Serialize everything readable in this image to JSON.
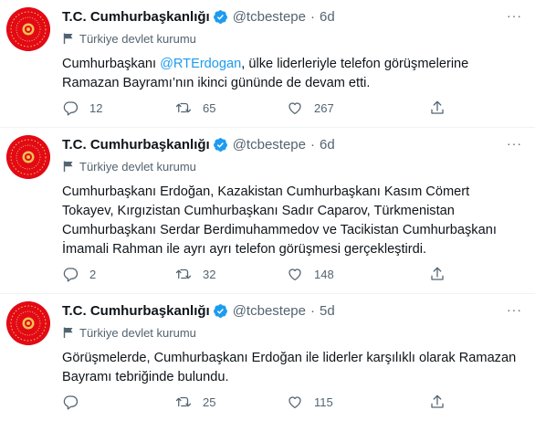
{
  "account": {
    "name": "T.C. Cumhurbaşkanlığı",
    "handle": "@tcbestepe",
    "dot": "·",
    "gov_label": "Türkiye devlet kurumu",
    "more": "···"
  },
  "colors": {
    "avatar_bg": "#e30a17",
    "verified": "#1d9bf0",
    "mention": "#1d9bf0",
    "muted": "#536471"
  },
  "tweets": [
    {
      "time": "6d",
      "text_before": "Cumhurbaşkanı ",
      "mention": "@RTErdogan",
      "text_after": ", ülke liderleriyle telefon görüşmelerine Ramazan Bayramı’nın ikinci gününde de devam etti.",
      "replies": "12",
      "retweets": "65",
      "likes": "267"
    },
    {
      "time": "6d",
      "text": "Cumhurbaşkanı Erdoğan, Kazakistan Cumhurbaşkanı Kasım Cömert Tokayev, Kırgızistan Cumhurbaşkanı Sadır Caparov, Türkmenistan Cumhurbaşkanı Serdar Berdimuhammedov ve Tacikistan Cumhurbaşkanı İmamali Rahman ile ayrı ayrı telefon görüşmesi gerçekleştirdi.",
      "replies": "2",
      "retweets": "32",
      "likes": "148"
    },
    {
      "time": "5d",
      "text": "Görüşmelerde, Cumhurbaşkanı Erdoğan ile liderler karşılıklı olarak Ramazan Bayramı tebriğinde bulundu.",
      "replies": "",
      "retweets": "25",
      "likes": "115"
    }
  ]
}
